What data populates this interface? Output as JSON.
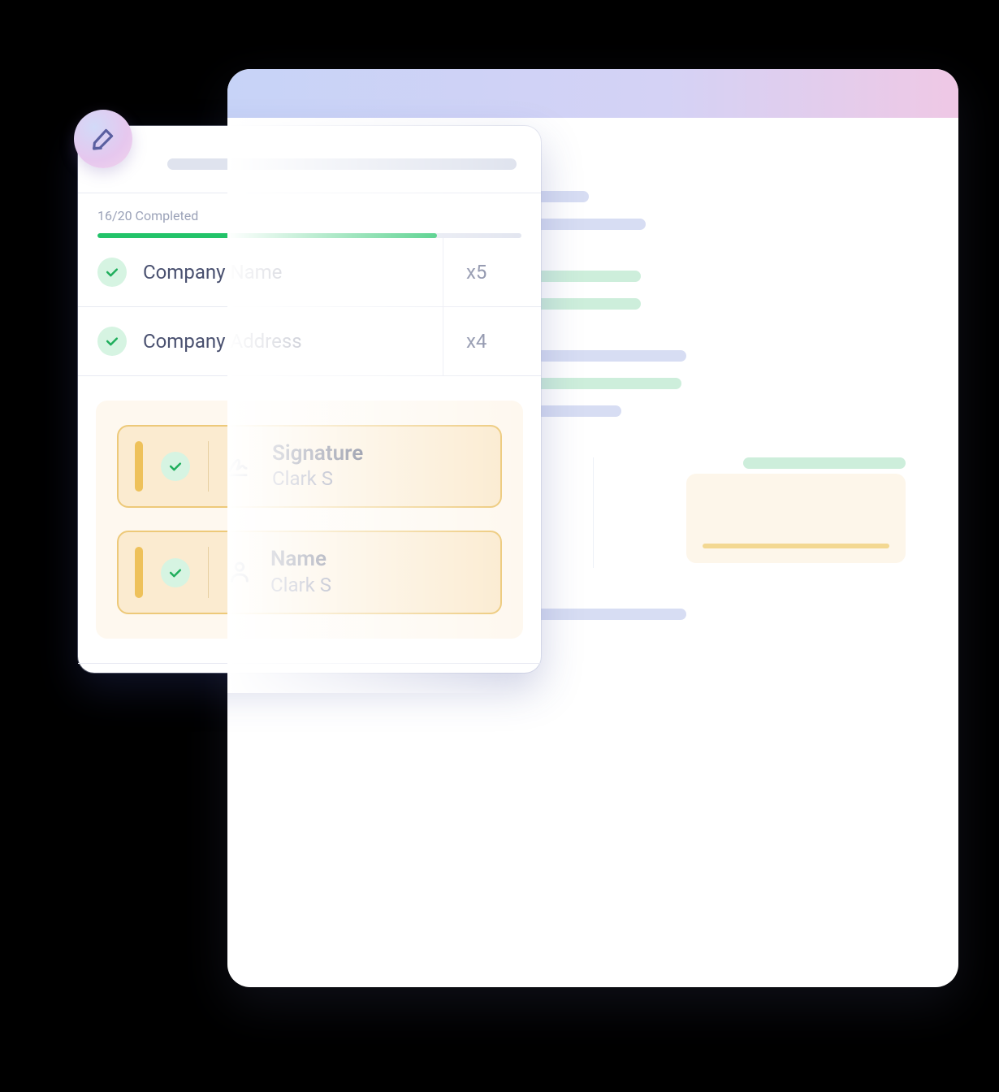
{
  "progress": {
    "label": "16/20 Completed",
    "done": 16,
    "total": 20,
    "percent": 80
  },
  "items": [
    {
      "label": "Company Name",
      "count": "x5"
    },
    {
      "label": "Company Address",
      "count": "x4"
    }
  ],
  "cards": [
    {
      "title": "Signature",
      "sub": "Clark S",
      "icon": "signature"
    },
    {
      "title": "Name",
      "sub": "Clark S",
      "icon": "person"
    }
  ],
  "colors": {
    "progress_fill": "#22c369",
    "card_bg": "#fbebd0",
    "card_border": "#edc979",
    "accent_stripe": "#eec15a"
  }
}
